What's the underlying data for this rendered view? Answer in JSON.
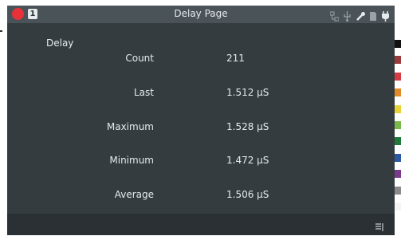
{
  "window": {
    "title": "Delay Page",
    "channel_badge": "1"
  },
  "status_icons": [
    "network-icon",
    "usb-icon",
    "probe-icon",
    "storage-icon",
    "power-icon"
  ],
  "section": {
    "label": "Delay"
  },
  "measurements": [
    {
      "label": "Count",
      "value": "211"
    },
    {
      "label": "Last",
      "value": "1.512  µS"
    },
    {
      "label": "Maximum",
      "value": "1.528  µS"
    },
    {
      "label": "Minimum",
      "value": "1.472  µS"
    },
    {
      "label": "Average",
      "value": "1.506  µS"
    }
  ],
  "colors": {
    "titlebar_bg": "#4a5358",
    "panel_bg": "#353c40",
    "footer_bg": "#2a3034",
    "record_dot": "#e8323a",
    "text": "#e6eaec"
  },
  "channel_swatches": [
    "#111111",
    "#9a3a3a",
    "#d43b45",
    "#e08a2a",
    "#e8d23a",
    "#79b84a",
    "#1f7a3a",
    "#2b5aa0",
    "#7a3a8a",
    "#8a8a8a",
    "#f4f4f4"
  ],
  "footer": {
    "menu_icon": "menu-lines-icon"
  }
}
